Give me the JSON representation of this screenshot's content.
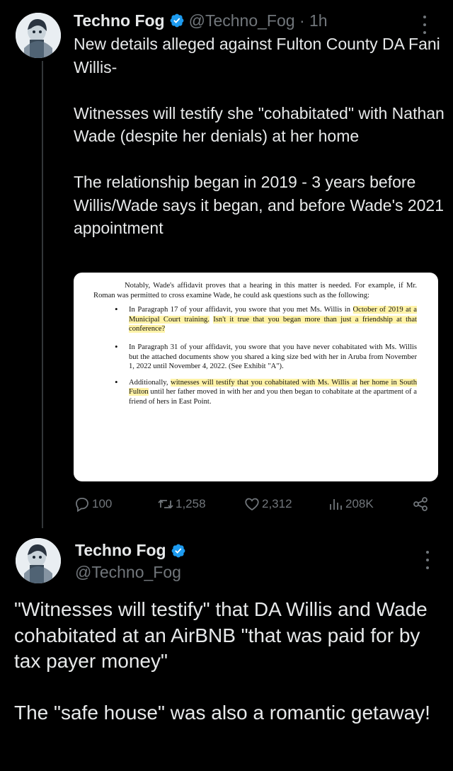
{
  "tweet1": {
    "display_name": "Techno Fog",
    "handle_meta": "@Techno_Fog · 1h",
    "text": [
      "New details alleged against Fulton County DA Fani Willis-",
      "",
      "Witnesses will testify she \"cohabitated\" with Nathan Wade (despite her denials) at her home",
      "",
      "The relationship began in 2019 - 3 years before Willis/Wade says it began, and before Wade's 2021 appointment"
    ],
    "document": {
      "intro": "Notably, Wade's affidavit proves that a hearing in this matter is needed. For example, if Mr. Roman was permitted to cross examine Wade, he could ask questions such as the following:",
      "b1_plain": "In Paragraph 17 of your affidavit, you swore that you met Ms. Willis in ",
      "b1_hl1": "October of 2019 at a Municipal Court training.",
      "b1_hl2": "Isn't it true that you began more than just a friendship at that conference?",
      "b2": "In Paragraph 31 of your affidavit, you swore that you have never cohabitated with Ms. Willis but the attached documents show you shared a king size bed with her in Aruba from November 1, 2022 until November 4, 2022. (See Exhibit \"A\").",
      "b3_plain1": "Additionally, ",
      "b3_hl1": "witnesses will testify that you cohabitated with Ms. Willis at",
      "b3_hl2": "her home in South Fulton",
      "b3_plain2": " until her father moved in with her and you then began to cohabitate at the apartment of a friend of hers in East Point."
    },
    "actions": {
      "replies": "100",
      "reposts": "1,258",
      "likes": "2,312",
      "views": "208K"
    },
    "icons": [
      "verified-badge-icon",
      "more-icon",
      "reply-icon",
      "repost-icon",
      "like-icon",
      "views-icon",
      "share-icon"
    ]
  },
  "tweet2": {
    "display_name": "Techno Fog",
    "handle": "@Techno_Fog",
    "text": [
      "\"Witnesses will testify\" that DA Willis and Wade cohabitated at an AirBNB \"that was paid for by tax payer money\"",
      "",
      "The \"safe house\" was also a romantic getaway!"
    ]
  },
  "colors": {
    "background": "#000000",
    "text": "#e7e9ea",
    "secondary": "#71767b",
    "verified": "#1d9bf0",
    "highlight": "#fff3a8"
  }
}
